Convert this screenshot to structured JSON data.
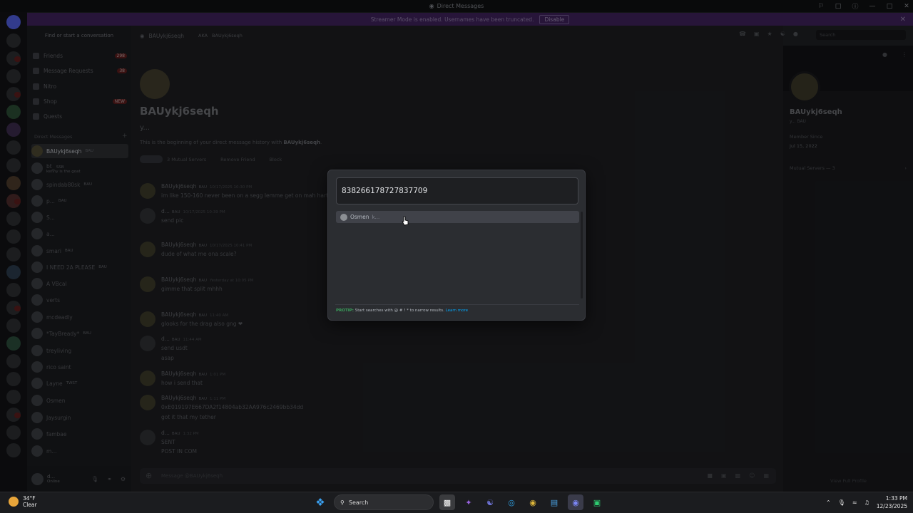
{
  "window": {
    "title": "Direct Messages"
  },
  "banner": {
    "text": "Streamer Mode is enabled. Usernames have been truncated.",
    "button": "Disable"
  },
  "sidebar": {
    "search_placeholder": "Find or start a conversation",
    "nav": [
      {
        "label": "Friends",
        "badge": "298"
      },
      {
        "label": "Message Requests",
        "badge": "38"
      },
      {
        "label": "Nitro",
        "badge": ""
      },
      {
        "label": "Shop",
        "badge": "NEW"
      },
      {
        "label": "Quests",
        "badge": ""
      }
    ],
    "dm_header": "Direct Messages",
    "dms": [
      {
        "name": "BAUykj6seqh",
        "tag": "BAU",
        "sub": ""
      },
      {
        "name": "bt_",
        "tag": "SSB",
        "sub": "kenny is the goat"
      },
      {
        "name": "spindab80sk",
        "tag": "BAU",
        "sub": ""
      },
      {
        "name": "p...",
        "tag": "BAU",
        "sub": ""
      },
      {
        "name": "S...",
        "tag": "",
        "sub": ""
      },
      {
        "name": "a...",
        "tag": "",
        "sub": ""
      },
      {
        "name": "smari",
        "tag": "BAU",
        "sub": ""
      },
      {
        "name": "I NEED 2A PLEASE",
        "tag": "BAU",
        "sub": ""
      },
      {
        "name": "A VBcal",
        "tag": "",
        "sub": ""
      },
      {
        "name": "verts",
        "tag": "",
        "sub": ""
      },
      {
        "name": "mcdeadly",
        "tag": "",
        "sub": ""
      },
      {
        "name": "*TayBready*",
        "tag": "BAU",
        "sub": ""
      },
      {
        "name": "treyliving",
        "tag": "",
        "sub": ""
      },
      {
        "name": "rico saint",
        "tag": "",
        "sub": ""
      },
      {
        "name": "Layne",
        "tag": "TWST",
        "sub": ""
      },
      {
        "name": "Osmen",
        "tag": "",
        "sub": ""
      },
      {
        "name": "Jaysurgin",
        "tag": "",
        "sub": ""
      },
      {
        "name": "fambae",
        "tag": "",
        "sub": ""
      },
      {
        "name": "m...",
        "tag": "",
        "sub": ""
      }
    ],
    "user": {
      "name": "d...",
      "status": "Online"
    }
  },
  "header": {
    "name": "BAUykj6seqh",
    "aka_label": "AKA",
    "aka": "BAUykj6seqh",
    "search_placeholder": "Search"
  },
  "main": {
    "name": "BAUykj6seqh",
    "subname": "y...",
    "intro_prefix": "This is the beginning of your direct message history with ",
    "intro_name": "BAUykj6seqh",
    "intro_suffix": ".",
    "mutual": "3 Mutual Servers",
    "remove_friend": "Remove Friend",
    "block": "Block",
    "messages": [
      {
        "author": "BAUykj6seqh",
        "tag": "BAU",
        "time": "10/17/2025 10:30 PM",
        "lines": [
          "im like 150-160 never been on a segg lemme get on mah hart"
        ],
        "grey": false
      },
      {
        "author": "d...",
        "tag": "BAU",
        "time": "10/17/2025 10:39 PM",
        "lines": [
          "send pic"
        ],
        "grey": true
      },
      {
        "author": "BAUykj6seqh",
        "tag": "BAU",
        "time": "10/17/2025 10:41 PM",
        "lines": [
          "dude of what me ona scale?"
        ],
        "grey": false
      },
      {
        "author": "BAUykj6seqh",
        "tag": "BAU",
        "time": "Yesterday at 10:05 PM",
        "lines": [
          "gimme that split mhhh"
        ],
        "grey": false
      },
      {
        "author": "BAUykj6seqh",
        "tag": "BAU",
        "time": "11:40 AM",
        "lines": [
          "glooks for the drag also gng ❤"
        ],
        "grey": false
      },
      {
        "author": "d...",
        "tag": "BAU",
        "time": "11:44 AM",
        "lines": [
          "send usdt",
          "asap"
        ],
        "grey": true
      },
      {
        "author": "BAUykj6seqh",
        "tag": "BAU",
        "time": "1:01 PM",
        "lines": [
          "how i send that"
        ],
        "grey": false
      },
      {
        "author": "BAUykj6seqh",
        "tag": "BAU",
        "time": "1:11 PM",
        "lines": [
          "0xE019197E667DA2f14804ab32AA976c2469bb34dd",
          "got it that my tether"
        ],
        "grey": false
      },
      {
        "author": "d...",
        "tag": "BAU",
        "time": "1:32 PM",
        "lines": [
          "SENT",
          "POST IN COM"
        ],
        "grey": true
      }
    ],
    "composer_placeholder": "Message @BAUykj6seqh"
  },
  "profile": {
    "name": "BAUykj6seqh",
    "sub": "y...   BAU",
    "member_since_label": "Member Since",
    "member_since": "Jul 15, 2022",
    "mutual_servers": "Mutual Servers — 3",
    "view_full": "View Full Profile"
  },
  "quick_switcher": {
    "query": "838266178727837709",
    "result_name": "Osmen",
    "result_hint": "k...",
    "protip_label": "PROTIP:",
    "protip_text": "Start searches with @ # ! * to narrow results.",
    "learn_more": "Learn more"
  },
  "taskbar": {
    "temp": "34°F",
    "weather": "Clear",
    "search": "Search",
    "time": "1:33 PM",
    "date": "12/23/2025"
  }
}
